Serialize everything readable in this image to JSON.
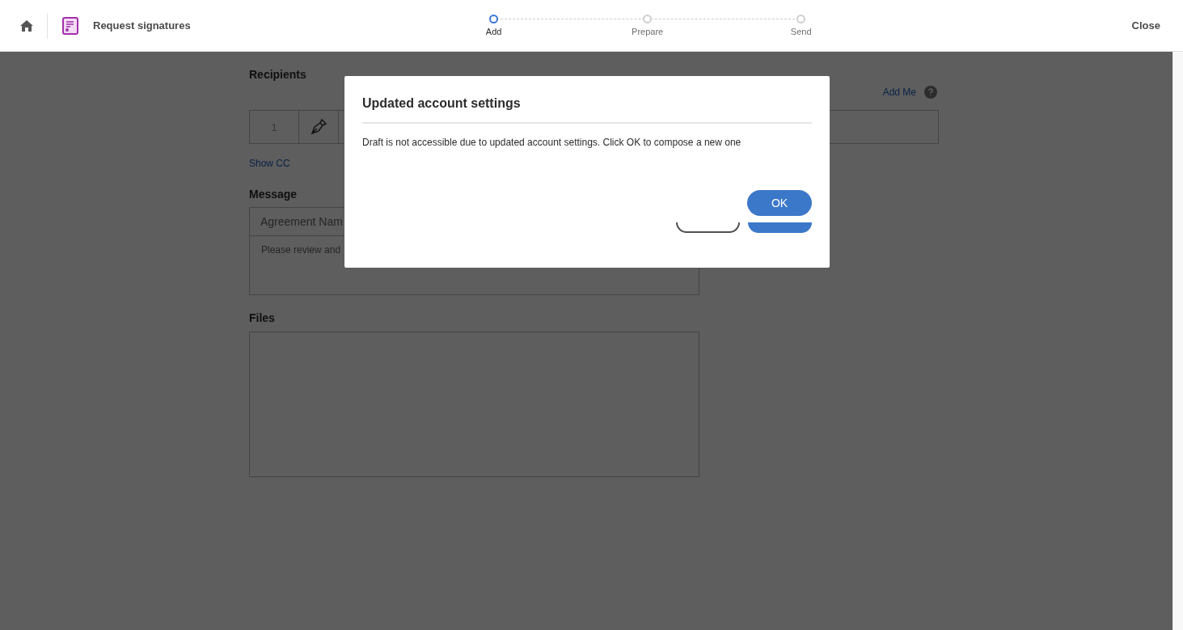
{
  "header": {
    "title": "Request signatures",
    "steps": [
      {
        "label": "Add",
        "selected": true
      },
      {
        "label": "Prepare",
        "selected": false
      },
      {
        "label": "Send",
        "selected": false
      }
    ],
    "close": "Close"
  },
  "form": {
    "recipients_heading": "Recipients",
    "add_me": "Add Me",
    "recipient": {
      "number": "1"
    },
    "show_cc": "Show CC",
    "message_heading": "Message",
    "agreement_name": "Agreement Nam",
    "message": "Please review and",
    "files_heading": "Files"
  },
  "dialog": {
    "title": "Updated account settings",
    "message": "Draft is not accessible due to updated account settings. Click OK to compose a new one",
    "ok": "OK"
  }
}
